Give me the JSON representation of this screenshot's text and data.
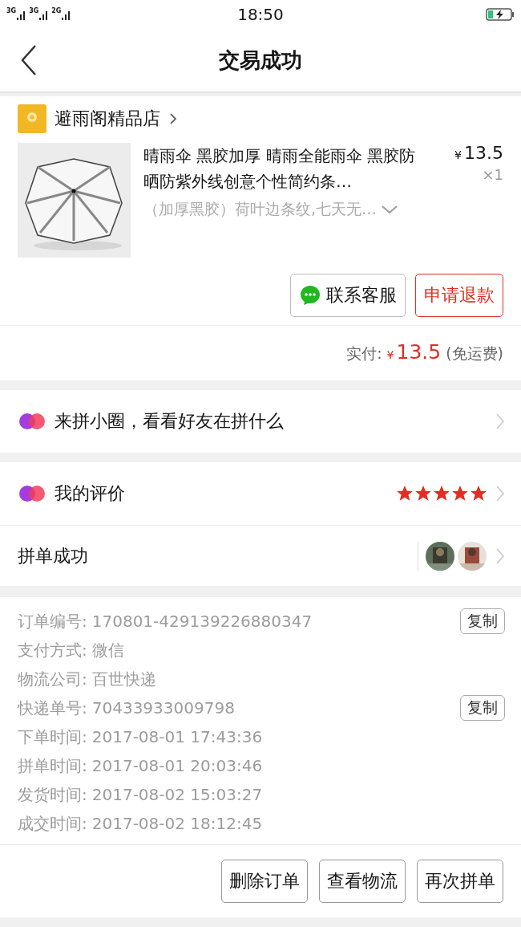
{
  "status_bar": {
    "networks": [
      "3G",
      "3G",
      "2G"
    ],
    "time": "18:50",
    "charging": true
  },
  "nav": {
    "title": "交易成功"
  },
  "shop": {
    "name": "避雨阁精品店"
  },
  "product": {
    "kind": "picture",
    "title": "晴雨伞 黑胶加厚 晴雨全能雨伞 黑胶防晒防紫外线创意个性简约条…",
    "variant": "（加厚黑胶）荷叶边条纹,七天无…",
    "currency": "¥",
    "price": "13.5",
    "quantity": "×1"
  },
  "actions": [
    "联系客服",
    "申请退款"
  ],
  "total": {
    "label": "实付:",
    "currency": "¥",
    "amount": "13.5",
    "note": "(免运费)"
  },
  "circle": {
    "label": "来拼小圈，看看好友在拼什么"
  },
  "rating": {
    "label": "我的评价",
    "stars": 5
  },
  "group": {
    "label": "拼单成功"
  },
  "info": [
    {
      "label": "订单编号:",
      "value": "170801-429139226880347",
      "action": "复制"
    },
    {
      "label": "支付方式:",
      "value": "微信"
    },
    {
      "label": "物流公司:",
      "value": "百世快递"
    },
    {
      "label": "快递单号:",
      "value": "70433933009798",
      "action": "复制"
    },
    {
      "label": "下单时间:",
      "value": "2017-08-01 17:43:36"
    },
    {
      "label": "拼单时间:",
      "value": "2017-08-01 20:03:46"
    },
    {
      "label": "发货时间:",
      "value": "2017-08-02 15:03:27"
    },
    {
      "label": "成交时间:",
      "value": "2017-08-02 18:12:45"
    }
  ],
  "footer_buttons": [
    "删除订单",
    "查看物流",
    "再次拼单"
  ]
}
